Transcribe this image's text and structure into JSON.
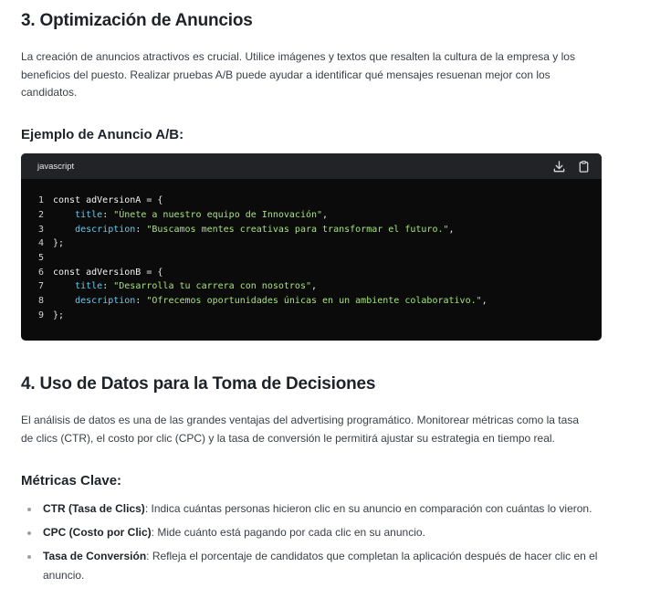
{
  "section3": {
    "heading": "3. Optimización de Anuncios",
    "paragraph": "La creación de anuncios atractivos es crucial. Utilice imágenes y textos que resalten la cultura de la empresa y los beneficios del puesto. Realizar pruebas A/B puede ayudar a identificar qué mensajes resuenan mejor con los candidatos.",
    "subheading": "Ejemplo de Anuncio A/B:"
  },
  "code": {
    "language": "javascript",
    "icons": [
      "download-icon",
      "copy-icon"
    ],
    "lines": [
      {
        "n": "1",
        "tokens": [
          [
            "kw",
            "const "
          ],
          [
            "var",
            "adVersionA"
          ],
          [
            "punc",
            " = {"
          ]
        ]
      },
      {
        "n": "2",
        "tokens": [
          [
            "punc",
            "    "
          ],
          [
            "prop",
            "title"
          ],
          [
            "punc",
            ": "
          ],
          [
            "str",
            "\"Únete a nuestro equipo de Innovación\""
          ],
          [
            "punc",
            ","
          ]
        ]
      },
      {
        "n": "3",
        "tokens": [
          [
            "punc",
            "    "
          ],
          [
            "prop",
            "description"
          ],
          [
            "punc",
            ": "
          ],
          [
            "str",
            "\"Buscamos mentes creativas para transformar el futuro.\""
          ],
          [
            "punc",
            ","
          ]
        ]
      },
      {
        "n": "4",
        "tokens": [
          [
            "punc",
            "};"
          ]
        ]
      },
      {
        "n": "5",
        "tokens": []
      },
      {
        "n": "6",
        "tokens": [
          [
            "kw",
            "const "
          ],
          [
            "var",
            "adVersionB"
          ],
          [
            "punc",
            " = {"
          ]
        ]
      },
      {
        "n": "7",
        "tokens": [
          [
            "punc",
            "    "
          ],
          [
            "prop",
            "title"
          ],
          [
            "punc",
            ": "
          ],
          [
            "str",
            "\"Desarrolla tu carrera con nosotros\""
          ],
          [
            "punc",
            ","
          ]
        ]
      },
      {
        "n": "8",
        "tokens": [
          [
            "punc",
            "    "
          ],
          [
            "prop",
            "description"
          ],
          [
            "punc",
            ": "
          ],
          [
            "str",
            "\"Ofrecemos oportunidades únicas en un ambiente colaborativo.\""
          ],
          [
            "punc",
            ","
          ]
        ]
      },
      {
        "n": "9",
        "tokens": [
          [
            "punc",
            "};"
          ]
        ]
      }
    ]
  },
  "section4": {
    "heading": "4. Uso de Datos para la Toma de Decisiones",
    "paragraph": "El análisis de datos es una de las grandes ventajas del advertising programático. Monitorear métricas como la tasa de clics (CTR), el costo por clic (CPC) y la tasa de conversión le permitirá ajustar su estrategia en tiempo real.",
    "subheading": "Métricas Clave:",
    "metrics": [
      {
        "term": "CTR (Tasa de Clics)",
        "desc": ": Indica cuántas personas hicieron clic en su anuncio en comparación con cuántas lo vieron."
      },
      {
        "term": "CPC (Costo por Clic)",
        "desc": ": Mide cuánto está pagando por cada clic en su anuncio."
      },
      {
        "term": "Tasa de Conversión",
        "desc": ": Refleja el porcentaje de candidatos que completan la aplicación después de hacer clic en el anuncio."
      }
    ]
  }
}
